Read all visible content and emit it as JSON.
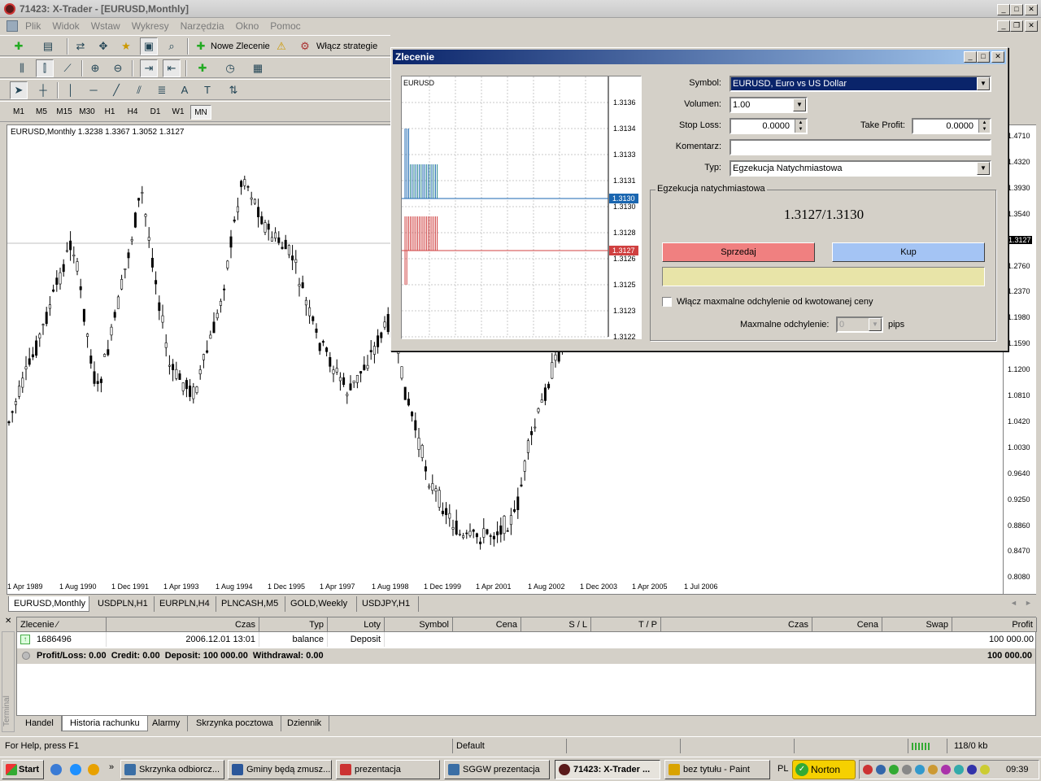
{
  "window": {
    "title": "71423: X-Trader - [EURUSD,Monthly]"
  },
  "menu": [
    "Plik",
    "Widok",
    "Wstaw",
    "Wykresy",
    "Narzędzia",
    "Okno",
    "Pomoc"
  ],
  "toolbar": {
    "new_order": "Nowe Zlecenie",
    "strategies": "Włącz strategie"
  },
  "timeframes": [
    "M1",
    "M5",
    "M15",
    "M30",
    "H1",
    "H4",
    "D1",
    "W1",
    "MN"
  ],
  "active_timeframe": "MN",
  "chart": {
    "header": "EURUSD,Monthly  1.3238 1.3367 1.3052 1.3127",
    "current_price": "1.3127",
    "price_ticks": [
      "1.4710",
      "1.4320",
      "1.3930",
      "1.3540",
      "1.3127",
      "1.2760",
      "1.2370",
      "1.1980",
      "1.1590",
      "1.1200",
      "1.0810",
      "1.0420",
      "1.0030",
      "0.9640",
      "0.9250",
      "0.8860",
      "0.8470",
      "0.8080"
    ],
    "date_ticks": [
      "1 Apr 1989",
      "1 Aug 1990",
      "1 Dec 1991",
      "1 Apr 1993",
      "1 Aug 1994",
      "1 Dec 1995",
      "1 Apr 1997",
      "1 Aug 1998",
      "1 Dec 1999",
      "1 Apr 2001",
      "1 Aug 2002",
      "1 Dec 2003",
      "1 Apr 2005",
      "1 Jul 2006"
    ],
    "tabs": [
      "EURUSD,Monthly",
      "USDPLN,H1",
      "EURPLN,H4",
      "PLNCASH,M5",
      "GOLD,Weekly",
      "USDJPY,H1"
    ]
  },
  "order_dialog": {
    "title": "Zlecenie",
    "tick_chart_symbol": "EURUSD",
    "tick_ticks": [
      "1.3136",
      "1.3134",
      "1.3133",
      "1.3131",
      "1.3130",
      "1.3128",
      "1.3126",
      "1.3125",
      "1.3123",
      "1.3122"
    ],
    "ask_marker": "1.3130",
    "bid_marker": "1.3127",
    "symbol_label": "Symbol:",
    "symbol_value": "EURUSD, Euro vs US Dollar",
    "volume_label": "Volumen:",
    "volume_value": "1.00",
    "sl_label": "Stop Loss:",
    "sl_value": "0.0000",
    "tp_label": "Take Profit:",
    "tp_value": "0.0000",
    "comment_label": "Komentarz:",
    "comment_value": "",
    "type_label": "Typ:",
    "type_value": "Egzekucja Natychmiastowa",
    "group_label": "Egzekucja natychmiastowa",
    "quote": "1.3127/1.3130",
    "sell_label": "Sprzedaj",
    "buy_label": "Kup",
    "deviation_check_label": "Włącz maxmalne odchylenie od kwotowanej ceny",
    "max_dev_label": "Maxmalne odchylenie:",
    "max_dev_value": "0",
    "pips_label": "pips"
  },
  "terminal": {
    "side_label": "Terminal",
    "columns": [
      "Zlecenie",
      "Czas",
      "Typ",
      "Loty",
      "Symbol",
      "Cena",
      "S / L",
      "T / P",
      "Czas",
      "Cena",
      "Swap",
      "Profit"
    ],
    "row": {
      "order": "1686496",
      "time": "2006.12.01 13:01",
      "type": "balance",
      "lots": "Deposit",
      "profit": "100 000.00"
    },
    "summary": "Profit/Loss: 0.00  Credit: 0.00  Deposit: 100 000.00  Withdrawal: 0.00",
    "summary_total": "100 000.00",
    "tabs": [
      "Handel",
      "Historia rachunku",
      "Alarmy",
      "Skrzynka pocztowa",
      "Dziennik"
    ],
    "active_tab": "Historia rachunku"
  },
  "status": {
    "help": "For Help, press F1",
    "profile": "Default",
    "traffic": "118/0 kb"
  },
  "taskbar": {
    "start": "Start",
    "tasks": [
      "Skrzynka odbiorcz...",
      "Gminy będą zmusz...",
      "prezentacja",
      "SGGW prezentacja",
      "71423: X-Trader ...",
      "bez tytułu - Paint"
    ],
    "active_task": "71423: X-Trader ...",
    "lang": "PL",
    "norton": "Norton",
    "clock": "09:39"
  }
}
